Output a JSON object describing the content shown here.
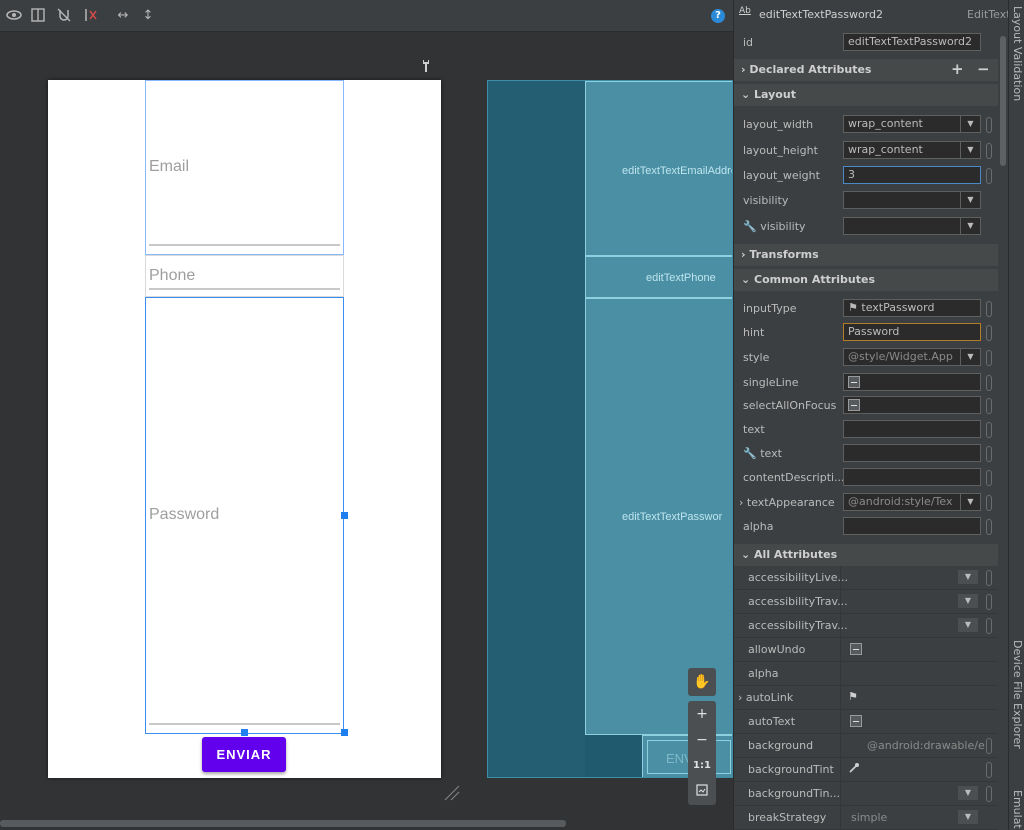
{
  "design": {
    "email_hint": "Email",
    "phone_hint": "Phone",
    "password_hint": "Password",
    "button_label": "ENVIAR",
    "help_label": "?"
  },
  "blueprint": {
    "email_label": "editTextTextEmailAddre",
    "phone_label": "editTextPhone",
    "password_label": "editTextTextPasswor",
    "button_label": "ENVI"
  },
  "zoom": {
    "one_to_one": "1:1"
  },
  "panel": {
    "badge": "Ab",
    "component_id": "editTextTextPassword2",
    "component_type": "EditText",
    "id_label": "id",
    "id_value": "editTextTextPassword2",
    "sections": {
      "declared": "Declared Attributes",
      "layout": "Layout",
      "transforms": "Transforms",
      "common": "Common Attributes",
      "all": "All Attributes"
    },
    "layout": [
      {
        "label": "layout_width",
        "value": "wrap_content"
      },
      {
        "label": "layout_height",
        "value": "wrap_content"
      },
      {
        "label": "layout_weight",
        "value": "3"
      },
      {
        "label": "visibility",
        "value": ""
      },
      {
        "label": "visibility",
        "value": ""
      }
    ],
    "common": [
      {
        "label": "inputType",
        "value": "textPassword"
      },
      {
        "label": "hint",
        "value": "Password"
      },
      {
        "label": "style",
        "value": "@style/Widget.App"
      },
      {
        "label": "singleLine",
        "value": ""
      },
      {
        "label": "selectAllOnFocus",
        "value": ""
      },
      {
        "label": "text",
        "value": ""
      },
      {
        "label": "text",
        "value": ""
      },
      {
        "label": "contentDescripti...",
        "value": ""
      },
      {
        "label": "textAppearance",
        "value": "@android:style/Tex"
      },
      {
        "label": "alpha",
        "value": ""
      }
    ],
    "all": [
      {
        "label": "accessibilityLive...",
        "value": ""
      },
      {
        "label": "accessibilityTrav...",
        "value": ""
      },
      {
        "label": "accessibilityTrav...",
        "value": ""
      },
      {
        "label": "allowUndo",
        "value": ""
      },
      {
        "label": "alpha",
        "value": ""
      },
      {
        "label": "autoLink",
        "value": ""
      },
      {
        "label": "autoText",
        "value": ""
      },
      {
        "label": "background",
        "value": "@android:drawable/e"
      },
      {
        "label": "backgroundTint",
        "value": ""
      },
      {
        "label": "backgroundTin...",
        "value": ""
      },
      {
        "label": "breakStrategy",
        "value": "simple"
      }
    ]
  },
  "side_tabs": {
    "layout_validation": "Layout Validation",
    "device_file_explorer": "Device File Explorer",
    "emulator": "Emulat"
  },
  "colors": {
    "accent_purple": "#6200ee",
    "selection_blue": "#1f7ef0",
    "blueprint_bg": "#1f5a6e",
    "focus_blue": "#4a88c7",
    "hint_outline": "#b07d2b"
  }
}
